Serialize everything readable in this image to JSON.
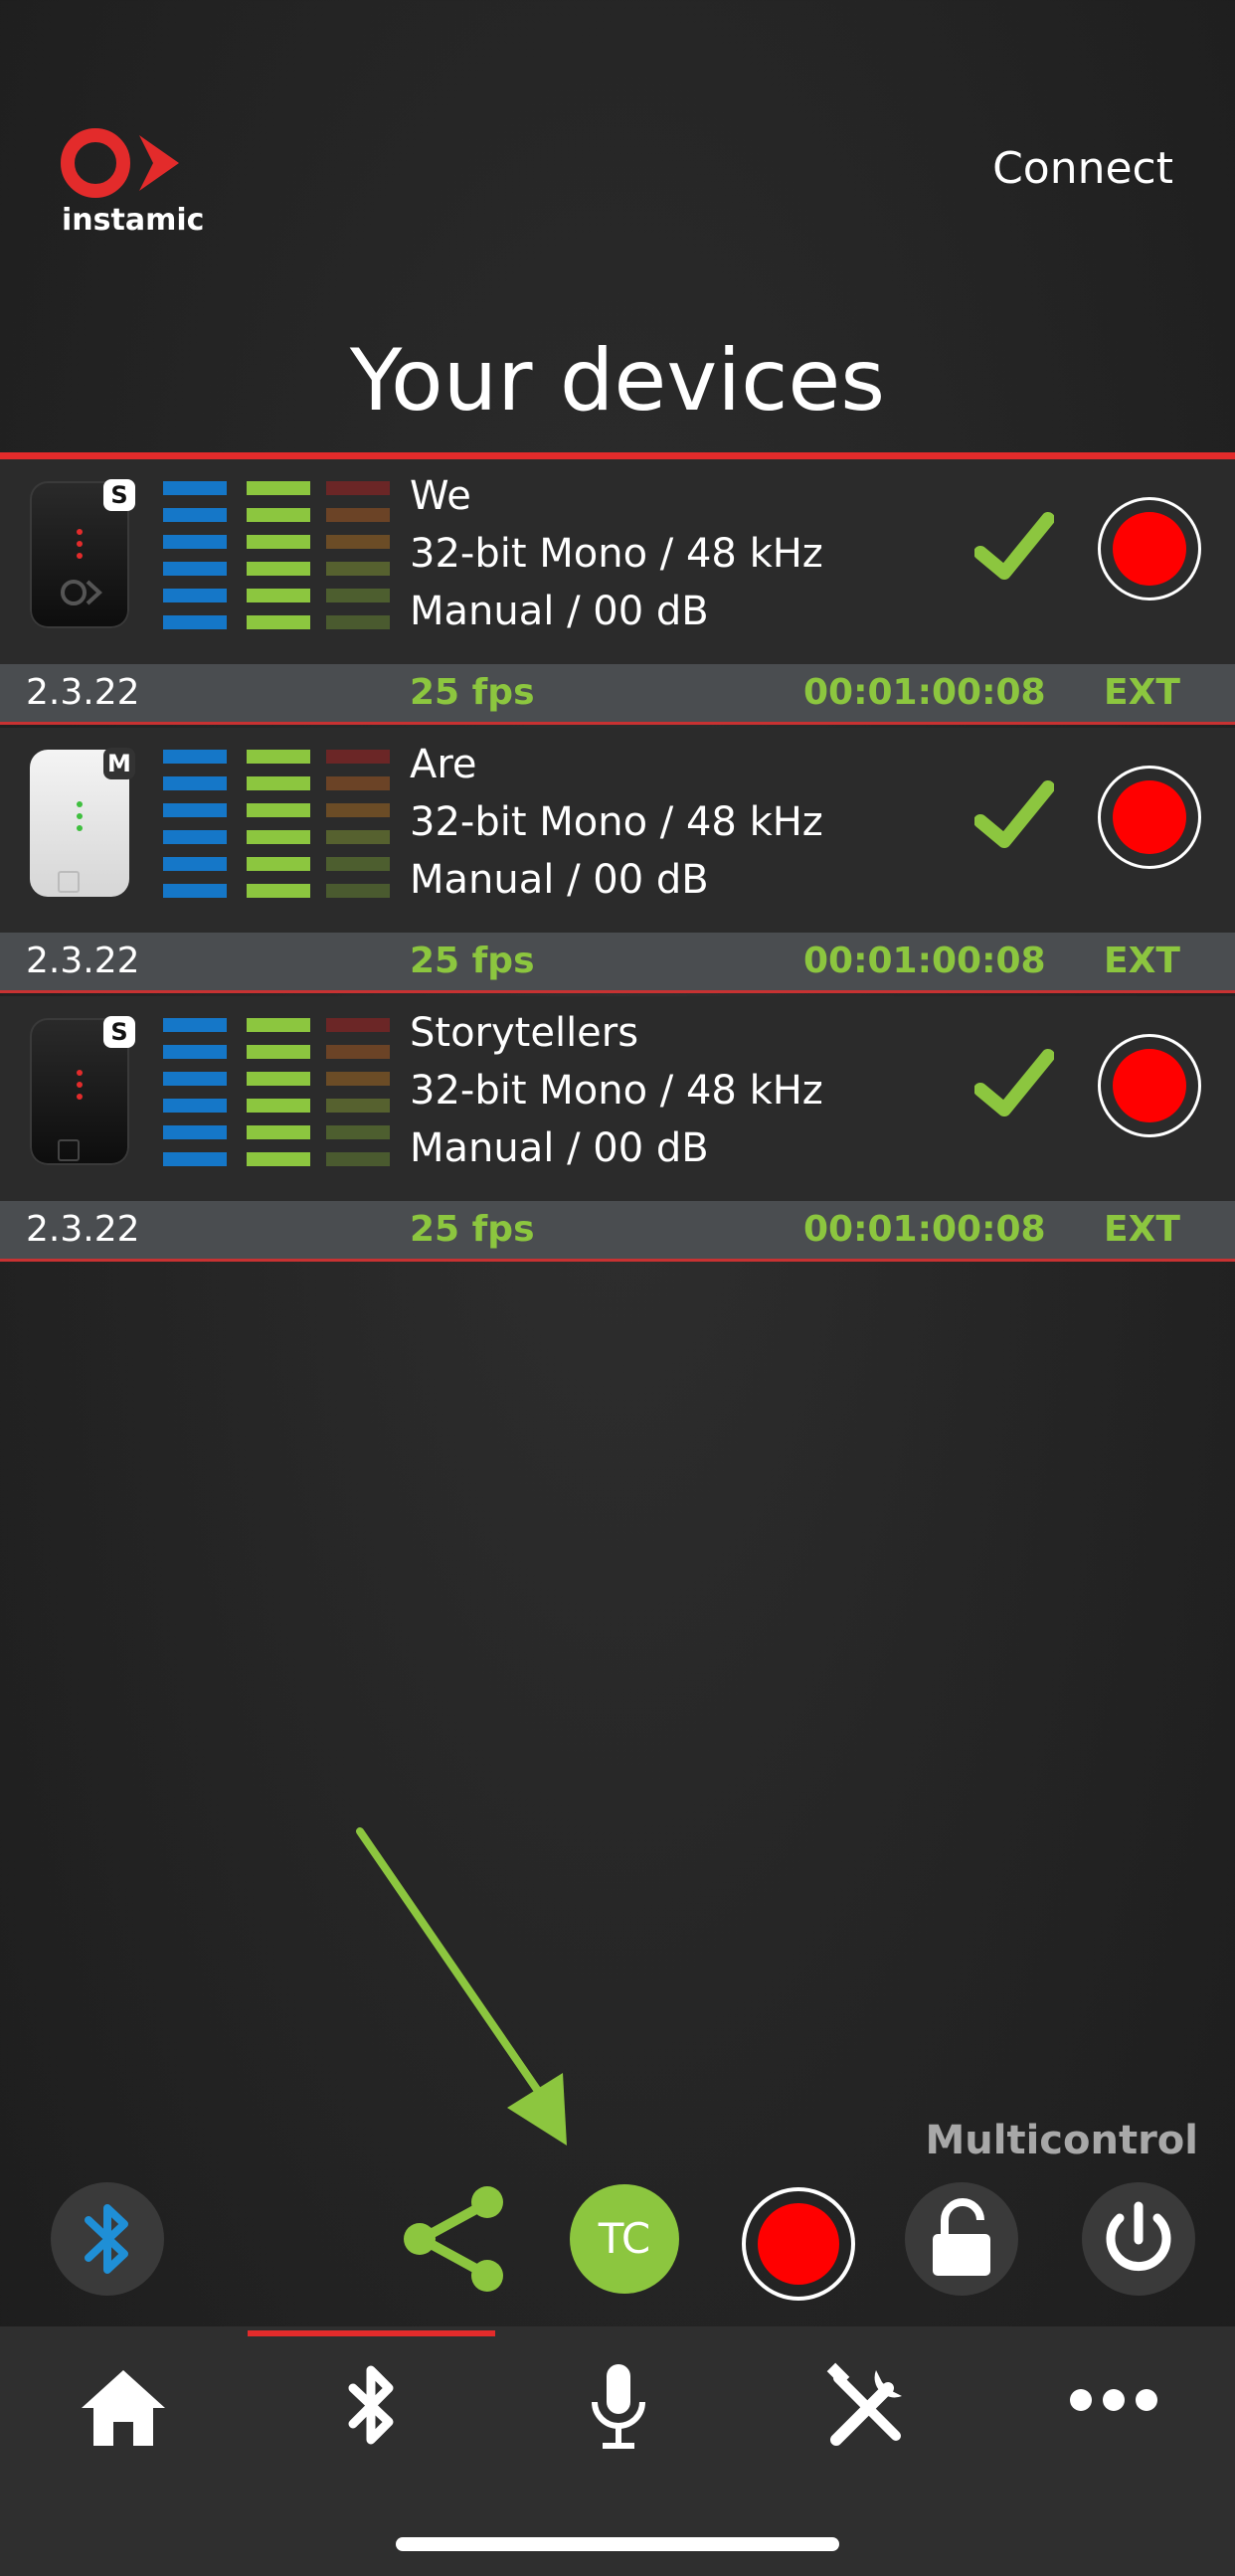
{
  "brand": {
    "logo_text": "instamic"
  },
  "header": {
    "connect_label": "Connect",
    "title": "Your devices"
  },
  "devices": [
    {
      "name": "We",
      "format": "32-bit Mono / 48 kHz",
      "gain": "Manual / 00 dB",
      "badge": "S",
      "version": "2.3.22",
      "fps": "25 fps",
      "timecode": "00:01:00:08",
      "sync": "EXT"
    },
    {
      "name": "Are",
      "format": "32-bit Mono / 48 kHz",
      "gain": "Manual / 00 dB",
      "badge": "M",
      "version": "2.3.22",
      "fps": "25 fps",
      "timecode": "00:01:00:08",
      "sync": "EXT"
    },
    {
      "name": "Storytellers",
      "format": "32-bit Mono / 48 kHz",
      "gain": "Manual / 00 dB",
      "badge": "S",
      "version": "2.3.22",
      "fps": "25 fps",
      "timecode": "00:01:00:08",
      "sync": "EXT"
    }
  ],
  "multicontrol": {
    "label": "Multicontrol",
    "tc_label": "TC",
    "buttons": [
      "bluetooth-icon",
      "share-icon",
      "tc",
      "record",
      "unlock-icon",
      "power-icon"
    ]
  },
  "tabs": [
    "home-icon",
    "bluetooth-icon",
    "microphone-icon",
    "tools-icon",
    "more-icon"
  ],
  "colors": {
    "accent_red": "#e32b2b",
    "record_red": "#ff0000",
    "status_green": "#8cc63f",
    "bluetooth_blue": "#1f8fd6",
    "meter_blue": "#1577c8"
  }
}
